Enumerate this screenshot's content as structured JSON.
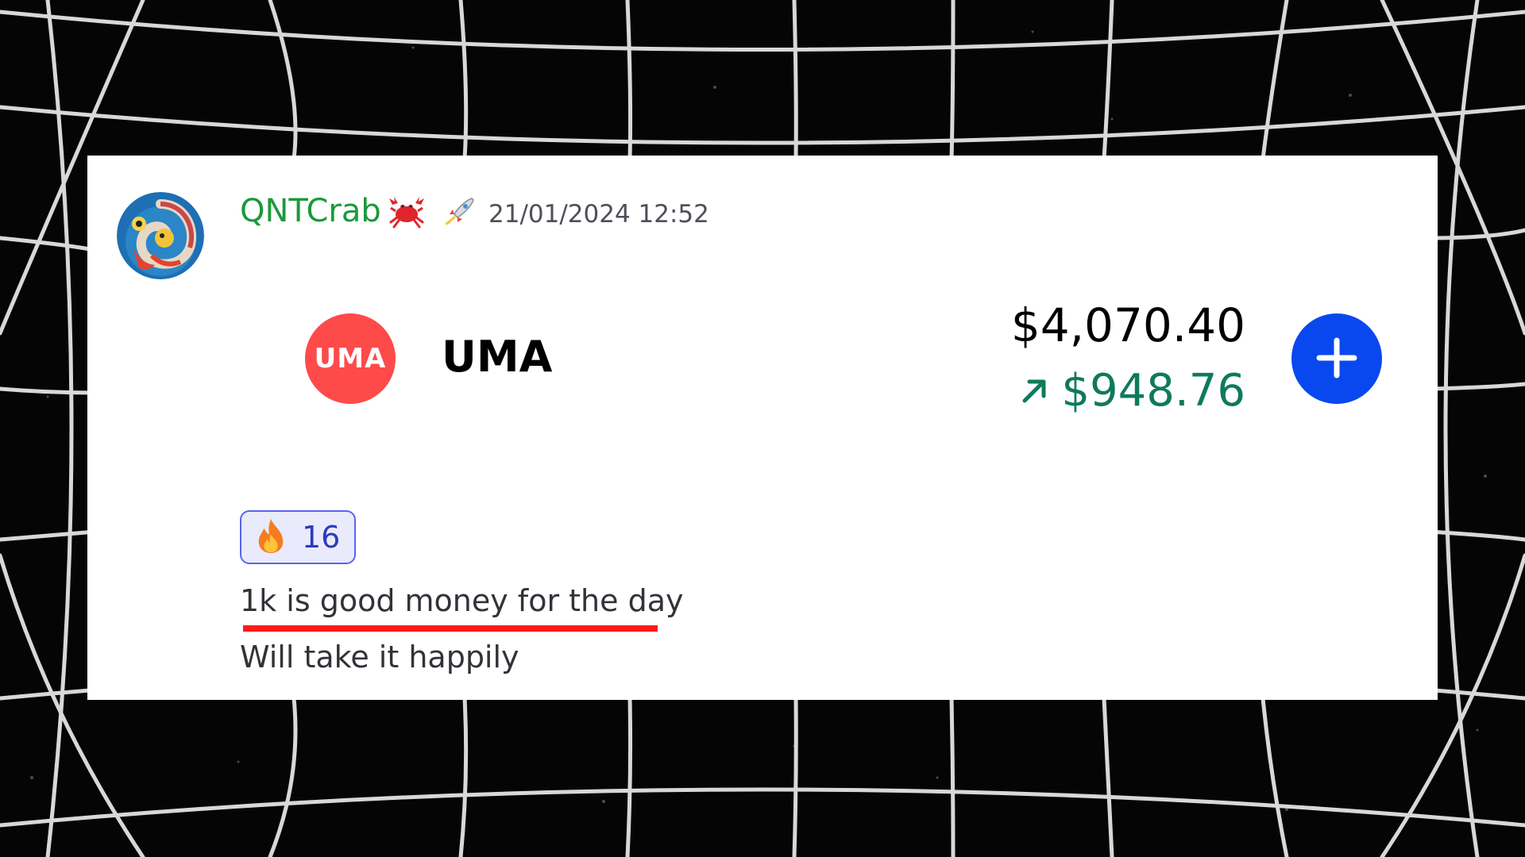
{
  "message": {
    "username": "QNTCrab",
    "username_color": "#1a9a3a",
    "badges": [
      "crab-icon",
      "rocket-icon"
    ],
    "timestamp": "21/01/2024 12:52",
    "avatar": "avatar"
  },
  "embed": {
    "token_logo_text": "UMA",
    "token_logo_color": "#ff4a4a",
    "token_name": "UMA",
    "total_value": "$4,070.40",
    "gain_value": "$948.76",
    "gain_color": "#0e7a5c",
    "gain_icon": "arrow-up-right-icon",
    "add_icon": "plus-icon",
    "add_button_color": "#0a48ef"
  },
  "reaction": {
    "emoji": "fire-icon",
    "count": "16"
  },
  "lines": [
    "1k is good money for the day",
    "Will take it happily"
  ],
  "accent": {
    "underline_color": "#ff1a1a"
  }
}
